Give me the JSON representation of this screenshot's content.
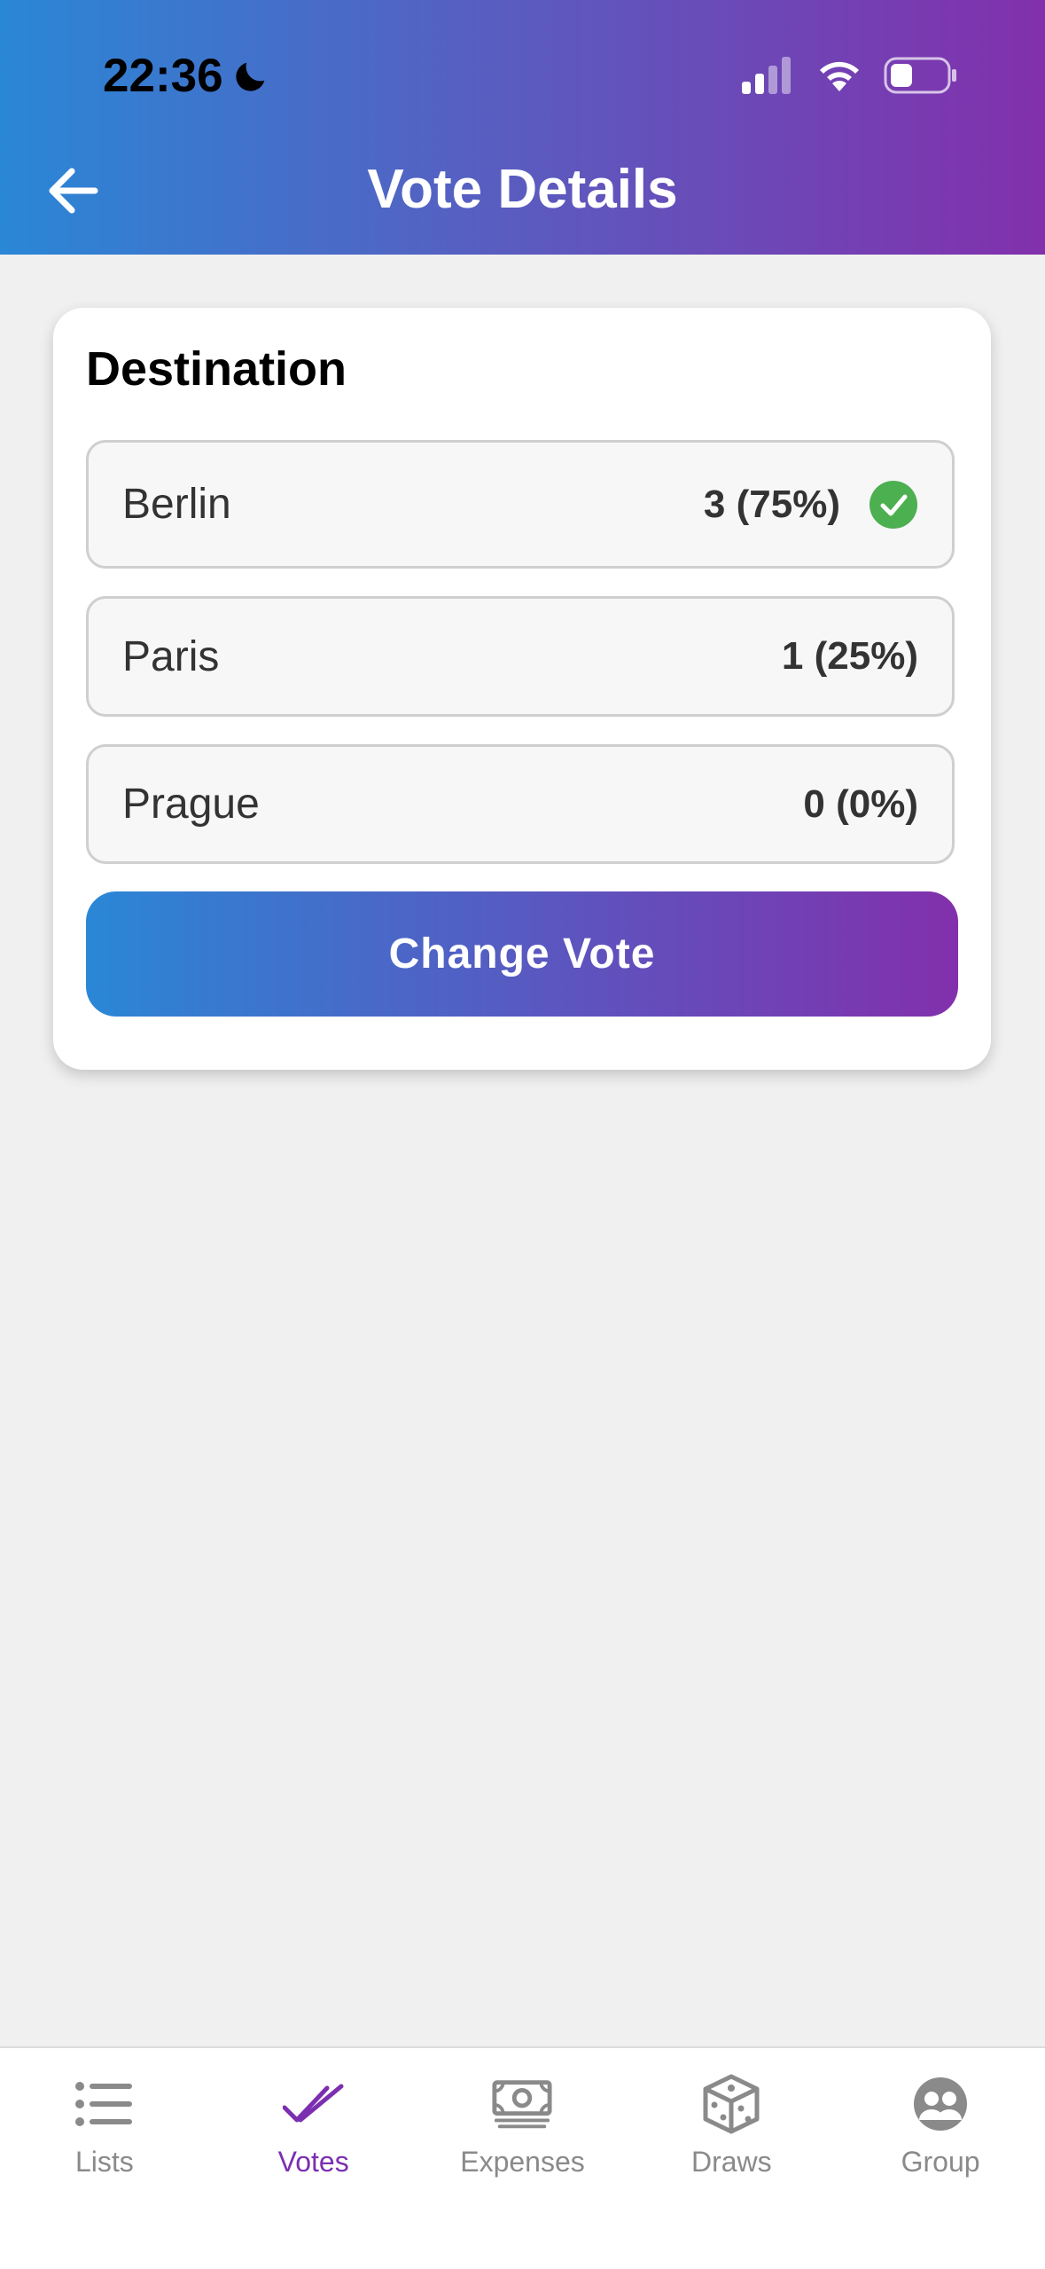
{
  "status_bar": {
    "time": "22:36"
  },
  "header": {
    "title": "Vote Details"
  },
  "vote": {
    "title": "Destination",
    "options": [
      {
        "label": "Berlin",
        "count": "3 (75%)",
        "selected": true
      },
      {
        "label": "Paris",
        "count": "1 (25%)",
        "selected": false
      },
      {
        "label": "Prague",
        "count": "0 (0%)",
        "selected": false
      }
    ],
    "change_label": "Change Vote"
  },
  "tabs": [
    {
      "label": "Lists",
      "icon": "list-icon",
      "active": false
    },
    {
      "label": "Votes",
      "icon": "double-check-icon",
      "active": true
    },
    {
      "label": "Expenses",
      "icon": "cash-icon",
      "active": false
    },
    {
      "label": "Draws",
      "icon": "dice-icon",
      "active": false
    },
    {
      "label": "Group",
      "icon": "group-icon",
      "active": false
    }
  ],
  "colors": {
    "gradient_start": "#2a87d6",
    "gradient_end": "#8230ac",
    "active_tab": "#7b2fb0",
    "check_green": "#4caf50"
  }
}
